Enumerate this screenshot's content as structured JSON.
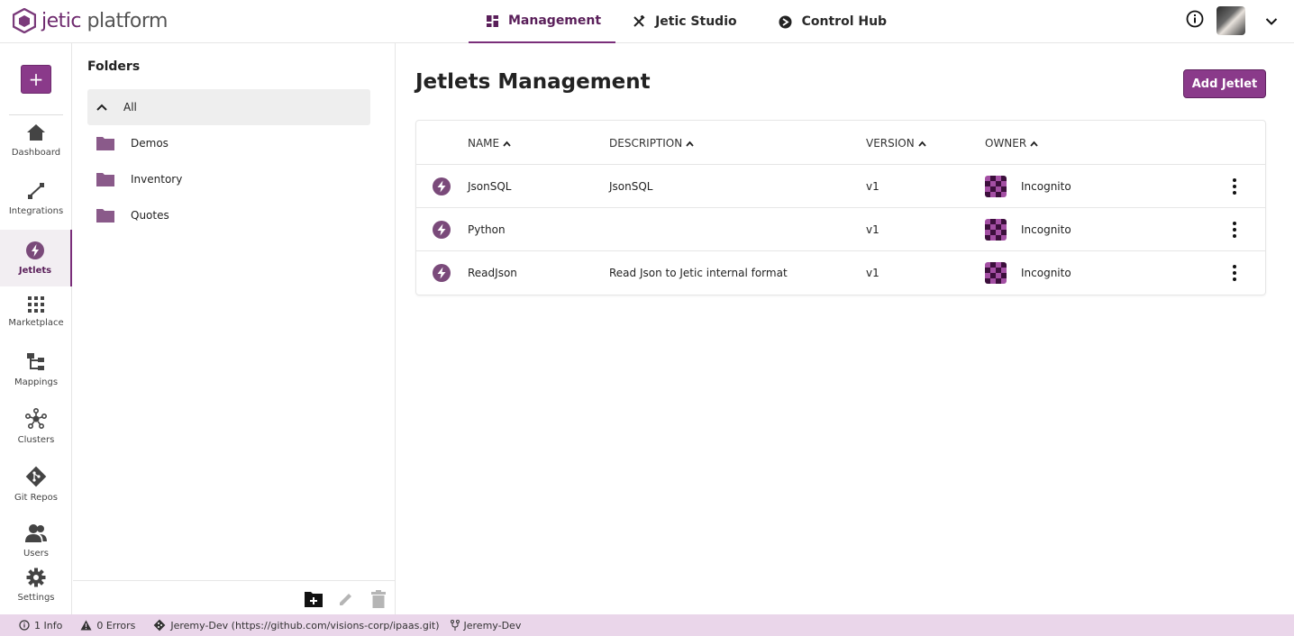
{
  "brand": {
    "name_part1": "jetic",
    "name_part2": " platform",
    "accent": "#7a2e7a"
  },
  "top_tabs": [
    {
      "label": "Management",
      "icon": "dashboard-grid-icon",
      "active": true
    },
    {
      "label": "Jetic Studio",
      "icon": "tools-icon",
      "active": false
    },
    {
      "label": "Control Hub",
      "icon": "hub-icon",
      "active": false
    }
  ],
  "top_right": {
    "info_icon": "info-icon",
    "avatar": "user-avatar",
    "menu_icon": "chevron-down-icon"
  },
  "leftnav": {
    "add_label": "+",
    "items": [
      {
        "label": "Dashboard",
        "icon": "home-icon"
      },
      {
        "label": "Integrations",
        "icon": "integration-icon"
      },
      {
        "label": "Jetlets",
        "icon": "bolt-icon",
        "active": true
      },
      {
        "label": "Marketplace",
        "icon": "apps-grid-icon"
      },
      {
        "label": "Mappings",
        "icon": "mapping-icon"
      },
      {
        "label": "Clusters",
        "icon": "cluster-icon"
      },
      {
        "label": "Git Repos",
        "icon": "git-icon"
      },
      {
        "label": "Users",
        "icon": "users-icon"
      },
      {
        "label": "Settings",
        "icon": "gear-icon"
      }
    ]
  },
  "folders": {
    "title": "Folders",
    "items": [
      {
        "label": "All",
        "selected": true
      },
      {
        "label": "Demos"
      },
      {
        "label": "Inventory"
      },
      {
        "label": "Quotes"
      }
    ]
  },
  "main": {
    "title": "Jetlets Management",
    "add_button": "Add Jetlet",
    "columns": [
      "NAME",
      "DESCRIPTION",
      "VERSION",
      "OWNER"
    ],
    "rows": [
      {
        "name": "JsonSQL",
        "description": "JsonSQL",
        "version": "v1",
        "owner": "Incognito"
      },
      {
        "name": "Python",
        "description": "",
        "version": "v1",
        "owner": "Incognito"
      },
      {
        "name": "ReadJson",
        "description": "Read Json to Jetic internal format",
        "version": "v1",
        "owner": "Incognito"
      }
    ]
  },
  "statusbar": {
    "info": "1 Info",
    "errors": "0 Errors",
    "repo": "Jeremy-Dev (https://github.com/visions-corp/ipaas.git)",
    "branch": "Jeremy-Dev"
  }
}
